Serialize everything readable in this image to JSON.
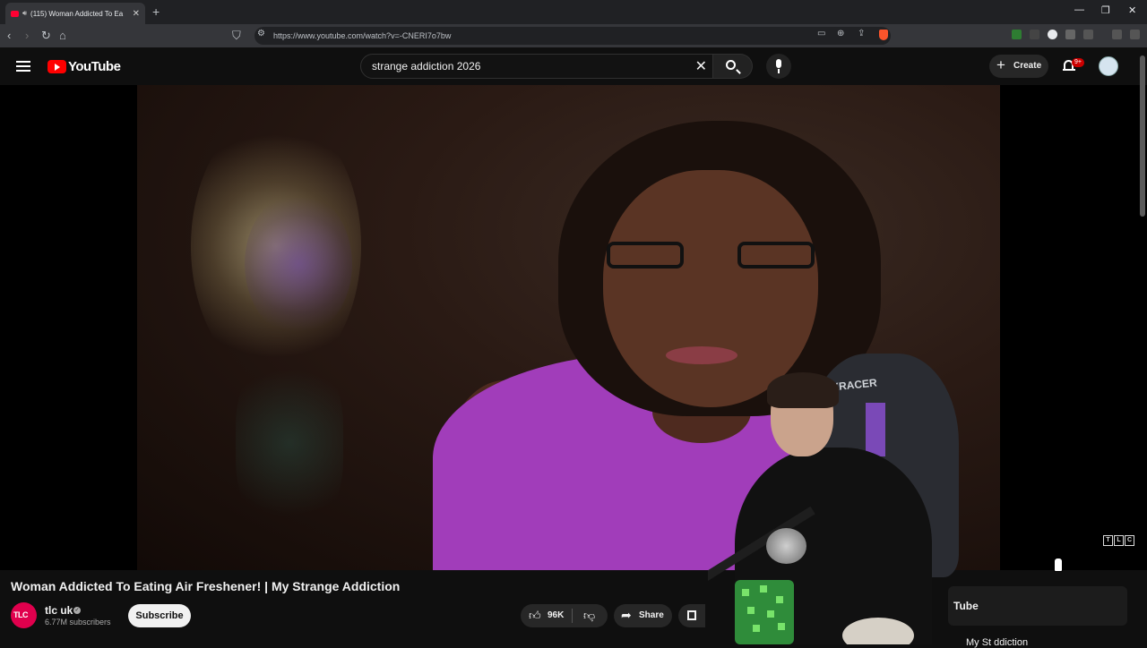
{
  "browser": {
    "tab_title": "(115) Woman Addicted To Ea",
    "url": "https://www.youtube.com/watch?v=-CNERI7o7bw"
  },
  "masthead": {
    "logo_text": "YouTube",
    "search_query": "strange addiction 2026",
    "create_label": "Create",
    "notification_count": "9+"
  },
  "video": {
    "title": "Woman Addicted To Eating Air Freshener! | My Strange Addiction",
    "watermark": "TLC",
    "webcam_chair_text": "XRACER"
  },
  "channel": {
    "avatar_text": "TLC",
    "name": "tlc uk",
    "subscribers": "6.77M subscribers",
    "subscribe_label": "Subscribe"
  },
  "actions": {
    "likes": "96K",
    "share_label": "Share"
  },
  "sidebar": {
    "card_text": "Tube",
    "card_text2": "My St          ddiction"
  },
  "icons": [
    "speaker-icon",
    "close-icon",
    "plus-icon",
    "back-icon",
    "forward-icon",
    "reload-icon",
    "home-icon",
    "bookmark-icon",
    "site-info-icon",
    "cast-icon",
    "zoom-icon",
    "share-page-icon",
    "brave-shield-icon",
    "hamburger-icon",
    "clear-icon",
    "search-icon",
    "mic-icon",
    "bell-icon",
    "like-icon",
    "dislike-icon",
    "share-icon",
    "save-icon"
  ],
  "colors": {
    "brand_red": "#ff0000",
    "background": "#0f0f0f",
    "tlc_pink": "#e0004d"
  }
}
